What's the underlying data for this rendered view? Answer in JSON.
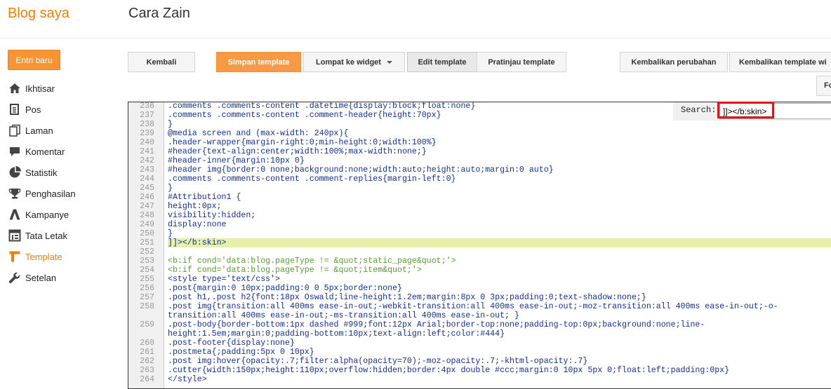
{
  "header": {
    "brand": "Blog saya",
    "blog_title": "Cara Zain"
  },
  "sidebar": {
    "new_post_label": "Entri baru",
    "items": [
      {
        "label": "Ikhtisar",
        "icon": "home-icon"
      },
      {
        "label": "Pos",
        "icon": "posts-icon"
      },
      {
        "label": "Laman",
        "icon": "pages-icon"
      },
      {
        "label": "Komentar",
        "icon": "comment-icon"
      },
      {
        "label": "Statistik",
        "icon": "pie-chart-icon"
      },
      {
        "label": "Penghasilan",
        "icon": "trophy-icon"
      },
      {
        "label": "Kampanye",
        "icon": "campaign-icon"
      },
      {
        "label": "Tata Letak",
        "icon": "layout-icon"
      },
      {
        "label": "Template",
        "icon": "template-icon",
        "active": true
      },
      {
        "label": "Setelan",
        "icon": "wrench-icon"
      }
    ]
  },
  "toolbar": {
    "back_label": "Kembali",
    "save_label": "Simpan template",
    "jump_label": "Lompat ke widget",
    "edit_label": "Edit template",
    "preview_label": "Pratinjau template",
    "revert_label": "Kembalikan perubahan",
    "revert_widget_label": "Kembalikan template wi",
    "fold_label": "Fo"
  },
  "editor": {
    "search_label": "Search:",
    "search_value": "]]></b:skin>",
    "lines": [
      {
        "n": "236",
        "code": ".comments .comments-content .datetime{display:block;float:none}"
      },
      {
        "n": "237",
        "code": ".comments .comments-content .comment-header{height:70px}"
      },
      {
        "n": "238",
        "code": "}"
      },
      {
        "n": "239",
        "code": "@media screen and (max-width: 240px){"
      },
      {
        "n": "240",
        "code": ".header-wrapper{margin-right:0;min-height:0;width:100%}"
      },
      {
        "n": "241",
        "code": "#header{text-align:center;width:100%;max-width:none;}"
      },
      {
        "n": "242",
        "code": "#header-inner{margin:10px 0}"
      },
      {
        "n": "243",
        "code": "#header img{border:0 none;background:none;width:auto;height:auto;margin:0 auto}"
      },
      {
        "n": "244",
        "code": ".comments .comments-content .comment-replies{margin-left:0}"
      },
      {
        "n": "245",
        "code": "}"
      },
      {
        "n": "246",
        "code": "#Attribution1 {"
      },
      {
        "n": "247",
        "code": "height:0px;"
      },
      {
        "n": "248",
        "code": "visibility:hidden;"
      },
      {
        "n": "249",
        "code": "display:none"
      },
      {
        "n": "250",
        "code": "}"
      },
      {
        "n": "251",
        "code": "]]></b:skin>",
        "highlight": true
      },
      {
        "n": "252",
        "code": ""
      },
      {
        "n": "253",
        "code": "<b:if cond='data:blog.pageType != &quot;static_page&quot;'>"
      },
      {
        "n": "254",
        "code": "<b:if cond='data:blog.pageType != &quot;item&quot;'>"
      },
      {
        "n": "255",
        "code": "<style type='text/css'>"
      },
      {
        "n": "256",
        "code": ".post{margin:0 10px;padding:0 0 5px;border:none}"
      },
      {
        "n": "257",
        "code": ".post h1,.post h2{font:18px Oswald;line-height:1.2em;margin:8px 0 3px;padding:0;text-shadow:none;}"
      },
      {
        "n": "258",
        "code": ".post img{transition:all 400ms ease-in-out;-webkit-transition:all 400ms ease-in-out;-moz-transition:all 400ms ease-in-out;-o-transition:all 400ms ease-in-out;-ms-transition:all 400ms ease-in-out; }"
      },
      {
        "n": "259",
        "code": ".post-body{border-bottom:1px dashed #999;font:12px Arial;border-top:none;padding-top:0px;background:none;line-height:1.5em;margin:0;padding-bottom:10px;text-align:left;color:#444}"
      },
      {
        "n": "260",
        "code": ".post-footer{display:none}"
      },
      {
        "n": "261",
        "code": ".postmeta{;padding:5px 0 10px}"
      },
      {
        "n": "262",
        "code": ".post img:hover{opacity:.7;filter:alpha(opacity=70);-moz-opacity:.7;-khtml-opacity:.7}"
      },
      {
        "n": "263",
        "code": ".cutter{width:150px;height:110px;overflow:hidden;border:4px double #ccc;margin:0 10px 5px 0;float:left;padding:0px}"
      },
      {
        "n": "264",
        "code": "</style>"
      }
    ]
  }
}
